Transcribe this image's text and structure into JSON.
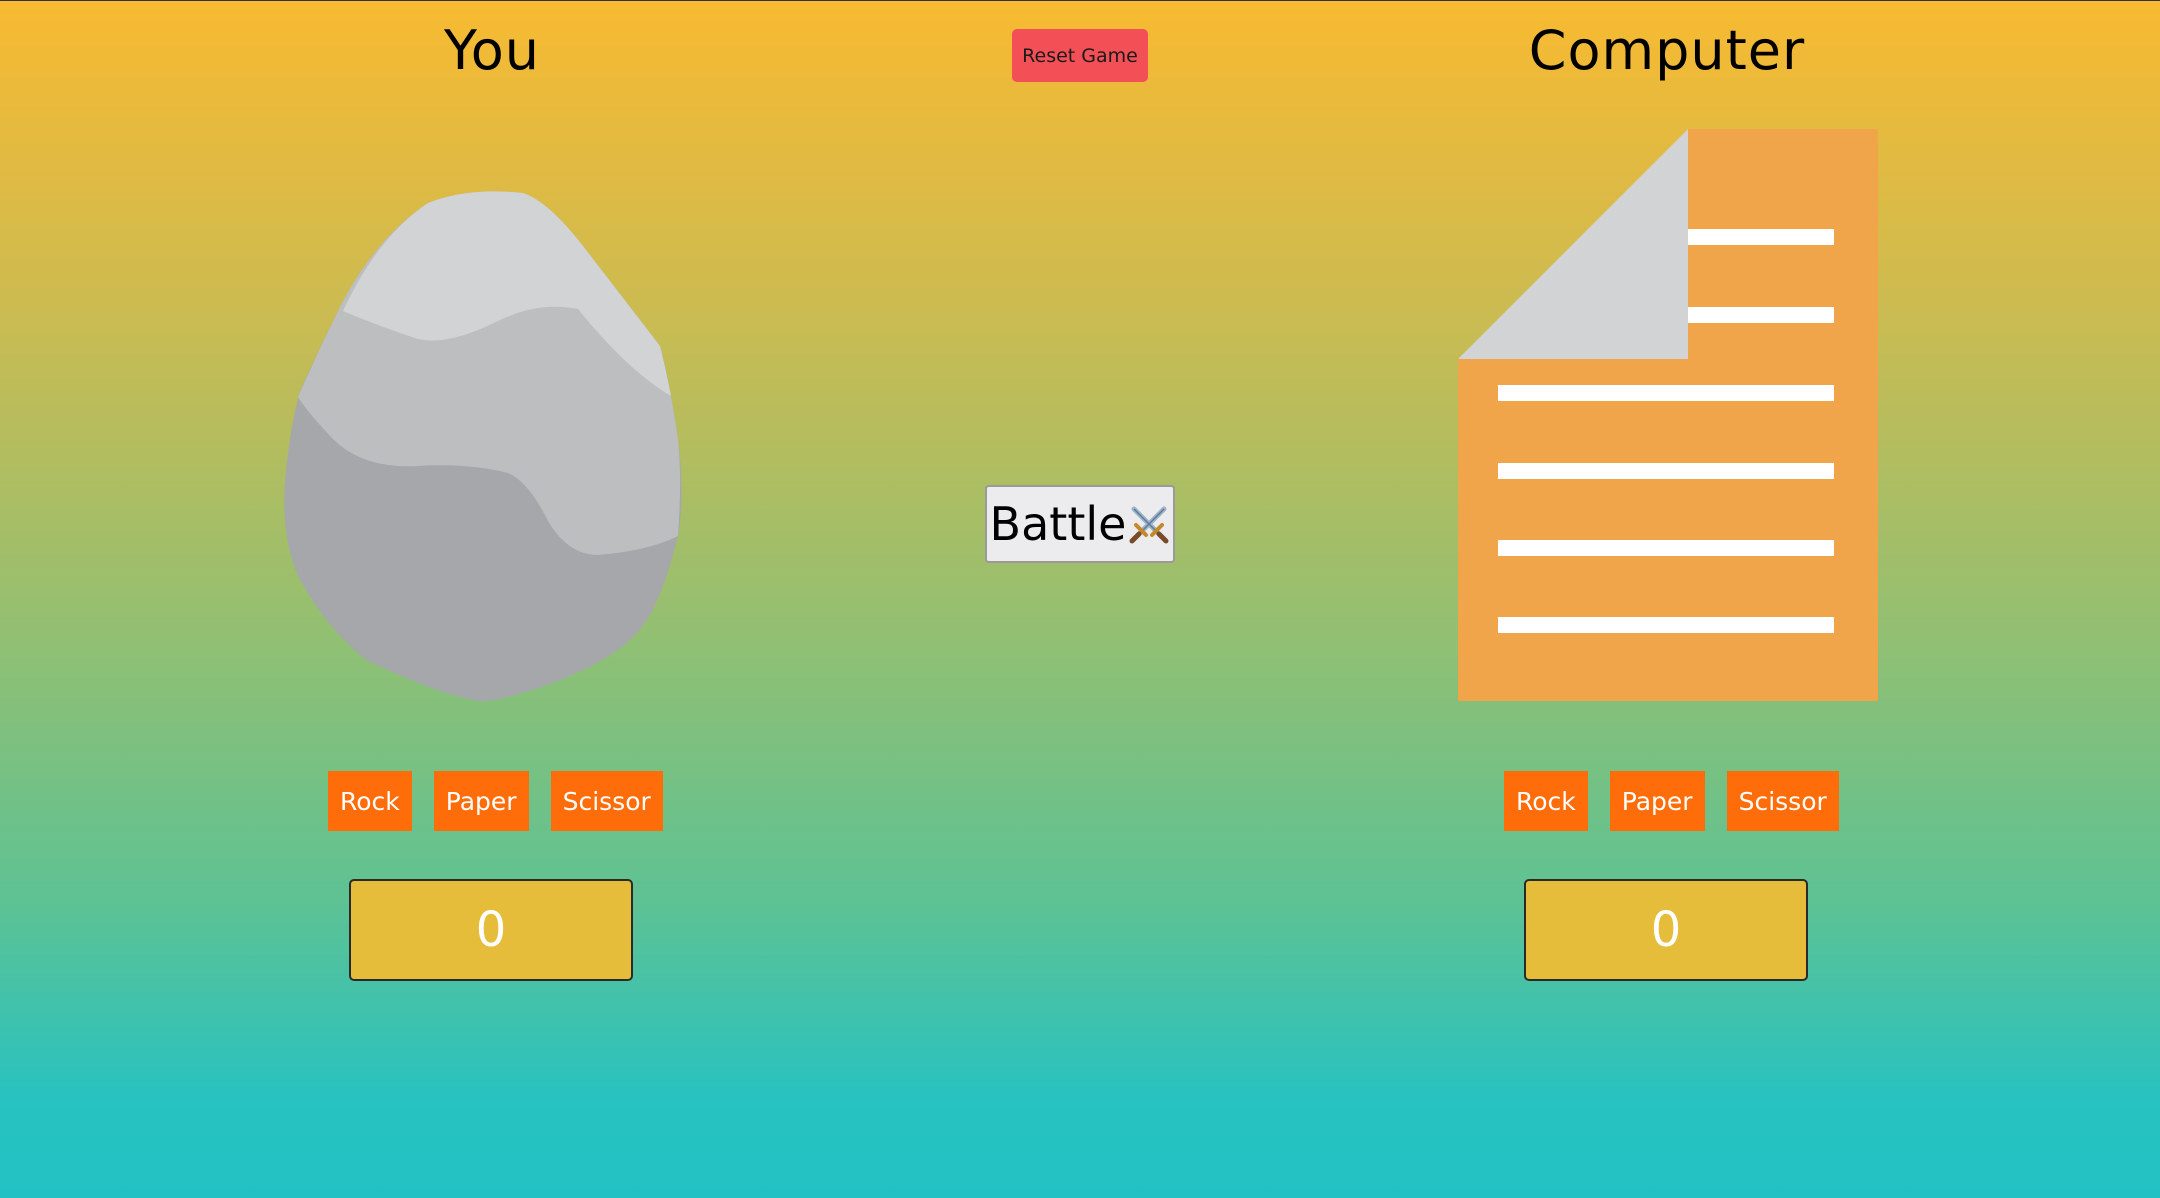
{
  "player": {
    "title": "You",
    "current_choice_icon": "rock-icon",
    "choices": [
      "Rock",
      "Paper",
      "Scissor"
    ],
    "score": "0"
  },
  "computer": {
    "title": "Computer",
    "current_choice_icon": "paper-icon",
    "choices": [
      "Rock",
      "Paper",
      "Scissor"
    ],
    "score": "0"
  },
  "controls": {
    "reset_label": "Reset Game",
    "battle_label": "Battle",
    "battle_icon": "crossed-swords-icon"
  },
  "colors": {
    "choice_button": "#ff6d0a",
    "reset_button": "#f24f57",
    "score_box": "#e6bd3a",
    "paper_body": "#f0a54a",
    "paper_fold": "#d1d3d4"
  }
}
